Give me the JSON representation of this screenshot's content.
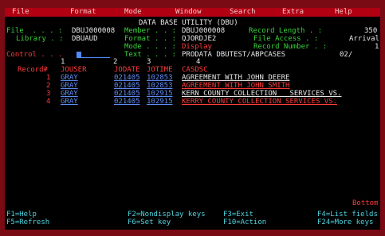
{
  "menu": [
    "File",
    "Format",
    "Mode",
    "Window",
    "Search",
    "Extra",
    "Help"
  ],
  "title": "DATA BASE UTILITY (DBU)",
  "header": {
    "file_label": "File  . . . :",
    "file_value": "DBUJ000008",
    "library_label": "Library . :",
    "library_value": "DBUAUD",
    "member_label": "Member . . :",
    "member_value": "DBUJ000008",
    "format_label": "Format . . :",
    "format_value": "QJORDJE2",
    "mode_label": "Mode . . . :",
    "mode_value": "Display",
    "text_label": "Text . . . :",
    "text_value": "PRODATA DBUTEST/ABPCASES",
    "text_suffix": "02/",
    "reclen_label": "Record Length . :",
    "reclen_value": "350",
    "access_label": "File Access . :",
    "access_value": "Arrival",
    "recnum_label": "Record Number . :",
    "recnum_value": "1",
    "control_label": "Control . . ."
  },
  "ruler": [
    "1",
    "2",
    "3",
    "4"
  ],
  "columns": [
    "Record#",
    "JOUSER",
    "JODATE",
    "JOTIME",
    "CASDSC"
  ],
  "rows": [
    {
      "rec": "1",
      "user": "GRAY",
      "date": "021405",
      "time": "102853",
      "desc": "AGREEMENT WITH JOHN DEERE"
    },
    {
      "rec": "2",
      "user": "GRAY",
      "date": "021405",
      "time": "102853",
      "desc": "AGREEMENT WITH JOHN SMITH"
    },
    {
      "rec": "3",
      "user": "GRAY",
      "date": "021405",
      "time": "102915",
      "desc": "KERN COUNTY COLLECTION   SERVICES VS."
    },
    {
      "rec": "4",
      "user": "GRAY",
      "date": "021405",
      "time": "102915",
      "desc": "KERRY COUNTY COLLECTION SERVICES VS."
    }
  ],
  "bottom_label": "Bottom",
  "fkeys": {
    "f1": "F1=Help",
    "f5": "F5=Refresh",
    "f2": "F2=Nondisplay keys",
    "f6": "F6=Set key",
    "f3": "F3=Exit",
    "f10": "F10=Action",
    "f4": "F4=List fields",
    "f24": "F24=More keys"
  }
}
